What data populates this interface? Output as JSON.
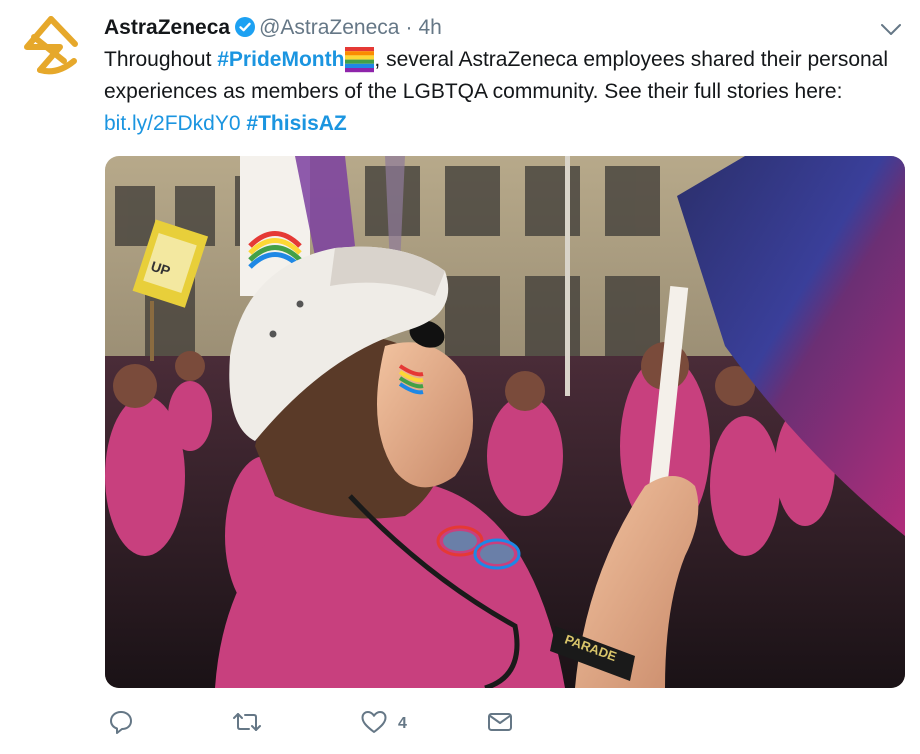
{
  "tweet": {
    "display_name": "AstraZeneca",
    "handle": "@AstraZeneca",
    "separator": "·",
    "time": "4h",
    "verified_icon": "verified-badge-icon",
    "text": {
      "part1": "Throughout ",
      "hashtag1": "#PrideMonth",
      "emoji": "rainbow-flag-icon",
      "part2": ", several AstraZeneca employees shared their personal experiences as members of the LGBTQA community. See their full stories here: ",
      "link": "bit.ly/2FDkdY0",
      "space": " ",
      "hashtag2": "#ThisisAZ"
    },
    "photo": {
      "alt_subject": "pride-parade-photo",
      "sign_text": "UP",
      "wristband_text": "PARADE"
    }
  },
  "actions": {
    "reply_icon": "reply-icon",
    "retweet_icon": "retweet-icon",
    "like_icon": "heart-icon",
    "like_count": "4",
    "message_icon": "envelope-icon"
  },
  "colors": {
    "link": "#1b95e0",
    "muted": "#657786",
    "text": "#14171a",
    "brand_gold": "#E6A82B",
    "shirt_pink": "#C8407E"
  }
}
